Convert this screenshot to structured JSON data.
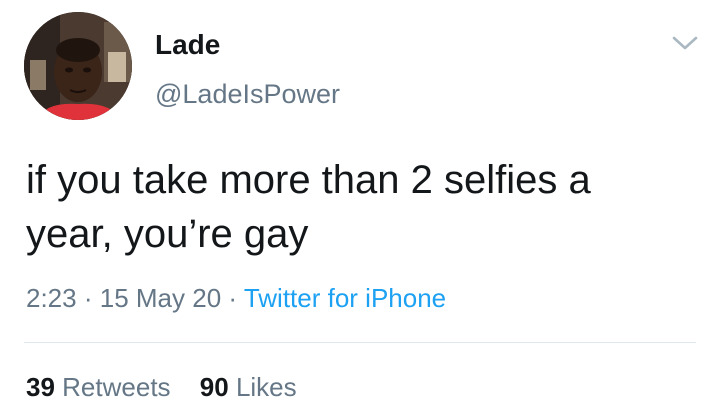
{
  "author": {
    "display_name": "Lade",
    "handle": "@LadeIsPower",
    "avatar_icon": "profile-photo"
  },
  "tweet": {
    "text_line1": "if you take more than 2 selfies a",
    "text_line2": "year, you’re gay"
  },
  "meta": {
    "time": "2:23",
    "separator": "·",
    "date": "15 May 20",
    "source": "Twitter for iPhone"
  },
  "stats": {
    "retweets_count": "39",
    "retweets_label": "Retweets",
    "likes_count": "90",
    "likes_label": "Likes"
  },
  "colors": {
    "text_primary": "#14171a",
    "text_secondary": "#657786",
    "link": "#1da1f2",
    "divider": "#e1e8ed"
  }
}
